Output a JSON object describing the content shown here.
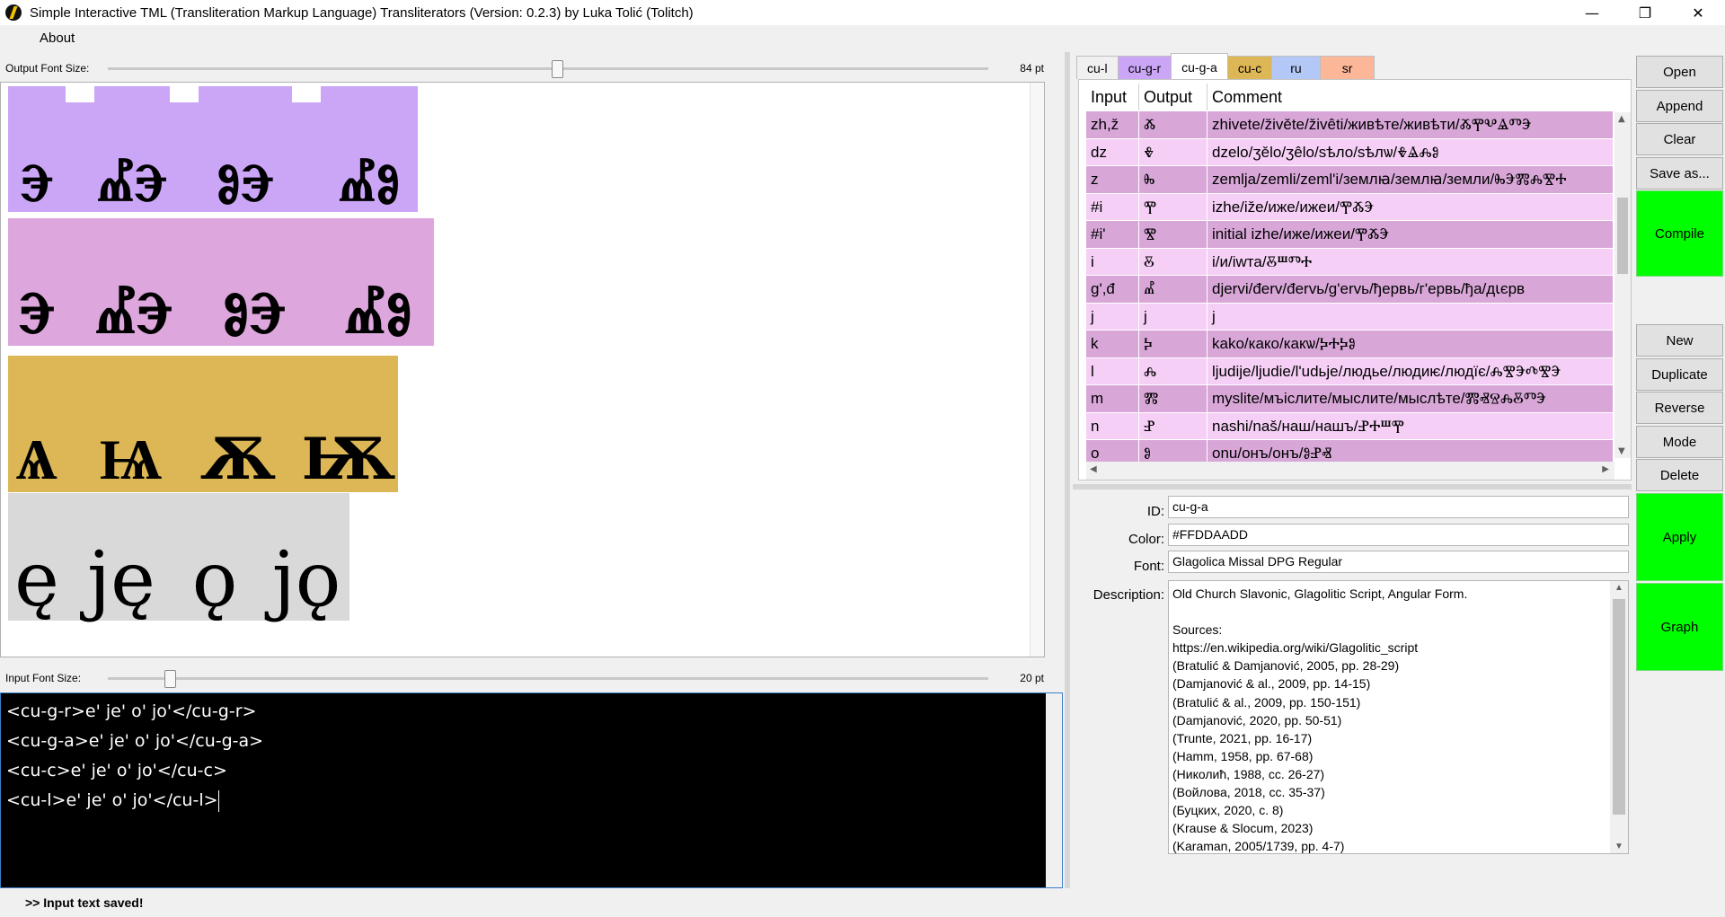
{
  "window": {
    "title": "Simple Interactive TML (Transliteration Markup Language) Transliterators (Version: 0.2.3) by Luka Tolić (Tolitch)",
    "minimize_glyph": "—",
    "restore_glyph": "❐",
    "close_glyph": "✕"
  },
  "menu": {
    "about": "About"
  },
  "output_font": {
    "label": "Output Font Size:",
    "value": "84 pt",
    "level_fraction": 0.51
  },
  "input_font": {
    "label": "Input Font Size:",
    "value": "20 pt",
    "level_fraction": 0.07
  },
  "output_lines": [
    {
      "color": "#cba6f7",
      "words": [
        "Ⰵ",
        "ⰌⰅ",
        "ⰑⰅ",
        "ⰌⰑ"
      ]
    },
    {
      "color": "#dda7dd",
      "words": [
        "Ⰵ",
        "ⰌⰅ",
        "ⰑⰅ",
        "ⰌⰑ"
      ]
    },
    {
      "color": "#ddb755",
      "words": [
        "Ѧ",
        "Ѩ",
        "Ѫ",
        "Ѭ"
      ]
    },
    {
      "color": "#d9d9d9",
      "words": [
        "ę",
        "ję",
        "ǫ",
        "jǫ"
      ]
    }
  ],
  "input_lines": [
    "<cu-g-r>e' je' o' jo'</cu-g-r>",
    "<cu-g-a>e' je' o' jo'</cu-g-a>",
    "<cu-c>e' je' o' jo'</cu-c>",
    "<cu-l>e' je' o' jo'</cu-l>"
  ],
  "status": ">> Input text saved!",
  "tabs": [
    {
      "label": "cu-l",
      "color": "#f0f0f0",
      "active": false
    },
    {
      "label": "cu-g-r",
      "color": "#cba6f7",
      "active": false
    },
    {
      "label": "cu-g-a",
      "color": "#ffffff",
      "active": true
    },
    {
      "label": "cu-c",
      "color": "#ddb755",
      "active": false
    },
    {
      "label": "ru",
      "color": "#b4c8f8",
      "active": false
    },
    {
      "label": "sr",
      "color": "#fbb797",
      "active": false
    }
  ],
  "table": {
    "headers": [
      "Input",
      "Output",
      "Comment"
    ],
    "rows": [
      {
        "input": "zh,ž",
        "output": "Ⰶ",
        "comment": "zhivete/živěte/živêti/живѣте/живѣти/ⰆⰉⰂⰡⰕⰅ"
      },
      {
        "input": "dz",
        "output": "Ⰷ",
        "comment": "dzelo/ʒělo/ʒêlo/ѕѣло/ѕѣлѡ/ⰇⰡⰎⰑ"
      },
      {
        "input": "z",
        "output": "Ⰸ",
        "comment": "zemlja/zemli/zeml'i/землꙗ/землꙗ/земли/ⰈⰅⰏⰎⰊⰀ"
      },
      {
        "input": "#i",
        "output": "Ⰹ",
        "comment": "izhe/iže/иже/ижеи/ⰉⰆⰅ"
      },
      {
        "input": "#i'",
        "output": "Ⰺ",
        "comment": "initial izhe/иже/ижеи/ⰉⰆⰅ"
      },
      {
        "input": "i",
        "output": "Ⰻ",
        "comment": "i/и/iwта/ⰋⰞⰕⰀ"
      },
      {
        "input": "g',đ",
        "output": "Ⰼ",
        "comment": "djervi/đerv/đervь/g'ervь/ђервь/г'ервь/ђa/дꙇєрв"
      },
      {
        "input": "j",
        "output": "j",
        "comment": "j"
      },
      {
        "input": "k",
        "output": "Ⰽ",
        "comment": "kako/како/какѡ/ⰍⰀⰍⰑ"
      },
      {
        "input": "l",
        "output": "Ⰾ",
        "comment": "ljudije/ljudie/l'udьje/людье/людиѥ/людїє/ⰎⰊⰅⰄⰊⰅ"
      },
      {
        "input": "m",
        "output": "Ⰿ",
        "comment": "myslite/мъіслите/мыслите/мыслѣте/ⰏⰟⰔⰎⰋⰕⰅ"
      },
      {
        "input": "n",
        "output": "Ⱀ",
        "comment": "nashi/naš/наш/нашъ/ⰐⰀⰞⰉ"
      },
      {
        "input": "o",
        "output": "Ⱁ",
        "comment": "onu/онъ/онъ/ⰑⰐⰟ"
      }
    ]
  },
  "props": {
    "id_label": "ID:",
    "id_value": "cu-g-a",
    "color_label": "Color:",
    "color_value": "#FFDDAADD",
    "font_label": "Font:",
    "font_value": "Glagolica Missal DPG Regular",
    "desc_label": "Description:",
    "description": [
      "Old Church Slavonic, Glagolitic Script, Angular Form.",
      "",
      "Sources:",
      "https://en.wikipedia.org/wiki/Glagolitic_script",
      "(Bratulić & Damjanović, 2005, pp. 28-29)",
      "(Damjanović & al., 2009, pp. 14-15)",
      "(Bratulić & al., 2009, pp. 150-151)",
      "(Damjanović, 2020, pp. 50-51)",
      "(Trunte, 2021, pp. 16-17)",
      "(Hamm, 1958, pp. 67-68)",
      "(Николић, 1988, cc. 26-27)",
      "(Войлова, 2018, cc. 35-37)",
      "(Буцких, 2020, c. 8)",
      "(Krause & Slocum, 2023)",
      "(Karaman, 2005/1739, pp. 4-7)"
    ]
  },
  "buttons": {
    "open": "Open",
    "append": "Append",
    "clear": "Clear",
    "save_as": "Save as...",
    "compile": "Compile",
    "new": "New",
    "duplicate": "Duplicate",
    "reverse": "Reverse",
    "mode": "Mode",
    "delete": "Delete",
    "apply": "Apply",
    "graph": "Graph"
  },
  "colors": {
    "green_button": "#00ff00",
    "input_bg": "#000000",
    "row_odd": "#d8a7d8",
    "row_even": "#f5cff5"
  }
}
